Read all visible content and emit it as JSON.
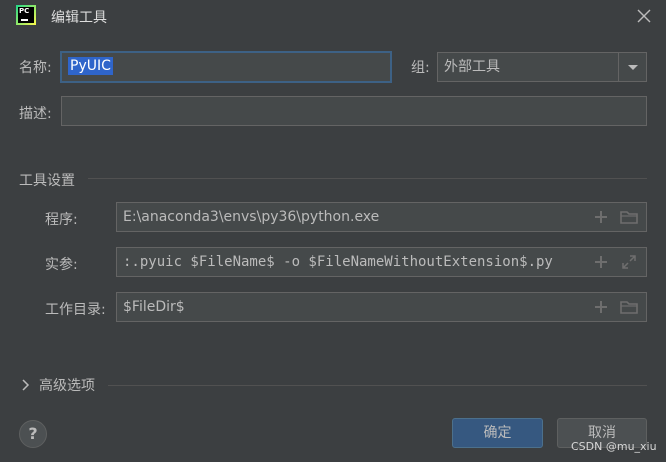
{
  "window": {
    "title": "编辑工具",
    "app_icon_text": "PC"
  },
  "form": {
    "name_label": "名称:",
    "name_value": "PyUIC",
    "group_label": "组:",
    "group_value": "外部工具",
    "desc_label": "描述:",
    "desc_value": ""
  },
  "tool_settings": {
    "section_title": "工具设置",
    "program_label": "程序:",
    "program_value": "E:\\anaconda3\\envs\\py36\\python.exe",
    "args_label": "实参:",
    "args_value": ":.pyuic $FileName$ -o $FileNameWithoutExtension$.py",
    "workdir_label": "工作目录:",
    "workdir_value": "$FileDir$"
  },
  "advanced": {
    "label": "高级选项"
  },
  "footer": {
    "ok_label": "确定",
    "cancel_label": "取消",
    "help_symbol": "?",
    "watermark": "CSDN @mu_xiu"
  }
}
